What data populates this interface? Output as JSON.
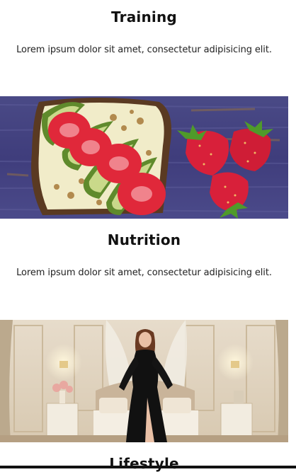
{
  "sections": [
    {
      "title": "Training",
      "description": "Lorem ipsum dolor sit amet, consectetur adipisicing elit."
    },
    {
      "title": "Nutrition",
      "description": "Lorem ipsum dolor sit amet, consectetur adipisicing elit."
    },
    {
      "title": "Lifestyle"
    }
  ]
}
